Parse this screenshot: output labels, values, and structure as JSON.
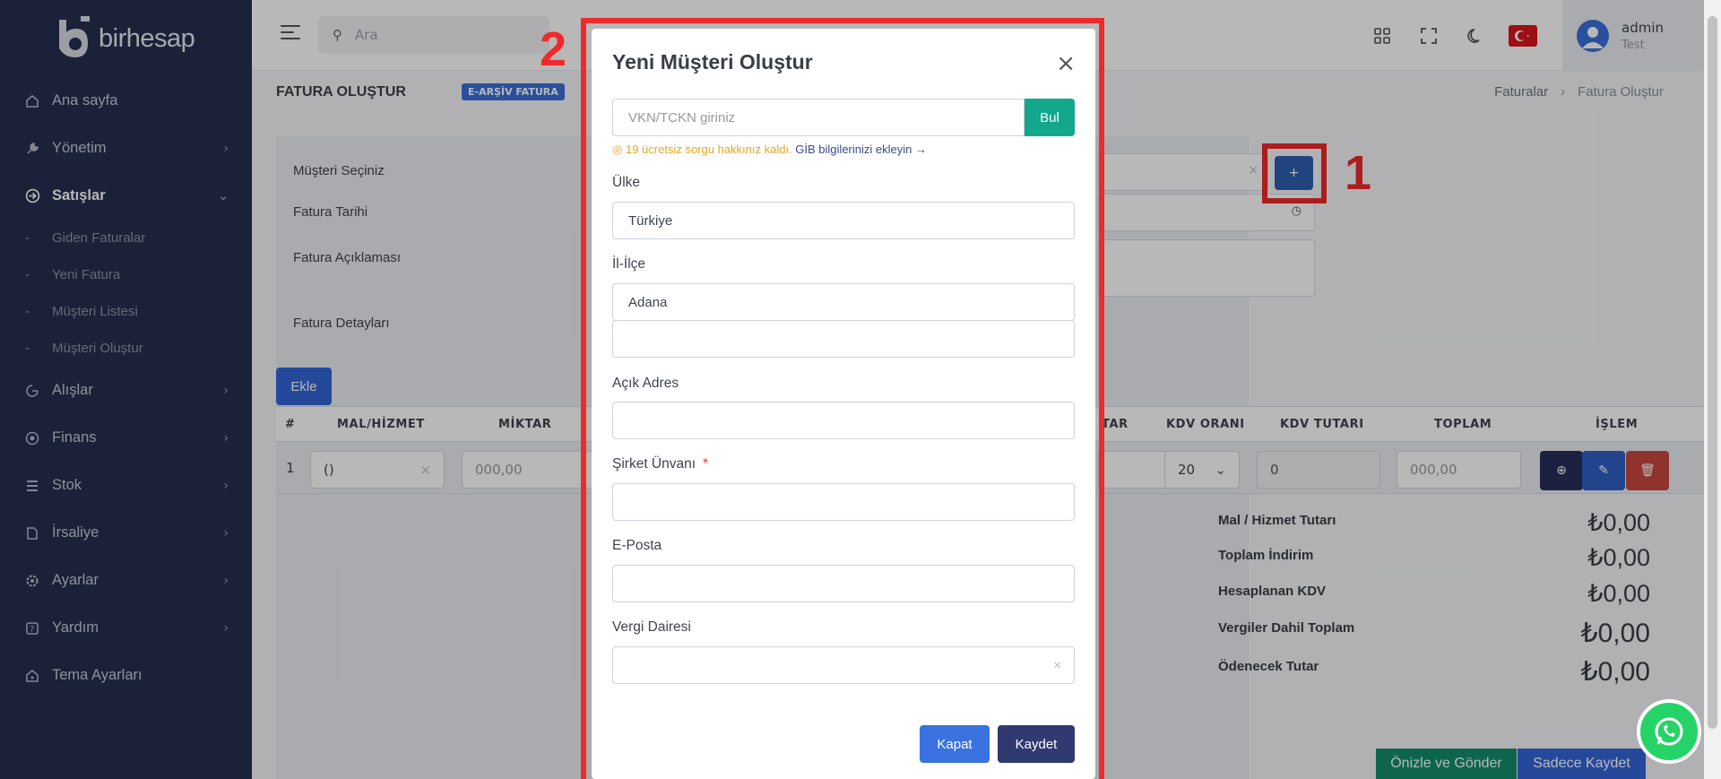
{
  "brand": {
    "name": "birhesap"
  },
  "sidebar": {
    "items": [
      {
        "label": "Ana sayfa",
        "icon": "home-icon",
        "has_children": false
      },
      {
        "label": "Yönetim",
        "icon": "wrench-icon",
        "has_children": true
      },
      {
        "label": "Satışlar",
        "icon": "sales-icon",
        "has_children": true,
        "expanded": true
      },
      {
        "label": "Alışlar",
        "icon": "purchases-icon",
        "has_children": true
      },
      {
        "label": "Finans",
        "icon": "finance-icon",
        "has_children": true
      },
      {
        "label": "Stok",
        "icon": "stock-icon",
        "has_children": true
      },
      {
        "label": "İrsaliye",
        "icon": "waybill-icon",
        "has_children": true
      },
      {
        "label": "Ayarlar",
        "icon": "gear-icon",
        "has_children": true
      },
      {
        "label": "Yardım",
        "icon": "help-icon",
        "has_children": true
      },
      {
        "label": "Tema Ayarları",
        "icon": "theme-icon",
        "has_children": false
      }
    ],
    "sales_sub": [
      "Giden Faturalar",
      "Yeni Fatura",
      "Müşteri Listesi",
      "Müşteri Oluştur"
    ]
  },
  "topbar": {
    "search_placeholder": "Ara",
    "user_name": "admin",
    "user_role": "Test"
  },
  "page": {
    "title": "FATURA OLUŞTUR",
    "badge": "E-ARŞİV FATURA",
    "breadcrumb": [
      "Faturalar",
      "Fatura Oluştur"
    ]
  },
  "form": {
    "labels": {
      "customer": "Müşteri Seçiniz",
      "date": "Fatura Tarihi",
      "description": "Fatura Açıklaması",
      "details": "Fatura Detayları"
    },
    "add_button": "Ekle",
    "plus_button": "+"
  },
  "table": {
    "headers": [
      "#",
      "MAL/HİZMET",
      "MİKTAR",
      "TAR",
      "KDV ORANI",
      "KDV TUTARI",
      "TOPLAM",
      "İŞLEM"
    ],
    "row": {
      "index": "1",
      "item": "()",
      "quantity": "000,00",
      "kdv_rate": "20",
      "kdv_amount": "0",
      "total": "000,00"
    }
  },
  "totals": [
    {
      "label": "Mal / Hizmet Tutarı",
      "value": "₺0,00"
    },
    {
      "label": "Toplam İndirim",
      "value": "₺0,00"
    },
    {
      "label": "Hesaplanan KDV",
      "value": "₺0,00"
    },
    {
      "label": "Vergiler Dahil Toplam",
      "value": "₺0,00"
    },
    {
      "label": "Ödenecek Tutar",
      "value": "₺0,00"
    }
  ],
  "bottom_buttons": {
    "preview_send": "Önizle ve Gönder",
    "save_only": "Sadece Kaydet"
  },
  "annotations": {
    "one": "1",
    "two": "2"
  },
  "modal": {
    "title": "Yeni Müşteri Oluştur",
    "vkn_placeholder": "VKN/TCKN giriniz",
    "find_button": "Bul",
    "note_warn": "19 ücretsiz sorgu hakkınız kaldı.",
    "note_link": "GİB bilgilerinizi ekleyin →",
    "country_label": "Ülke",
    "country_value": "Türkiye",
    "city_label": "İl-İlçe",
    "city_value": "Adana",
    "district_value": "",
    "address_label": "Açık Adres",
    "company_label": "Şirket Ünvanı",
    "company_required": "*",
    "email_label": "E-Posta",
    "tax_office_label": "Vergi Dairesi",
    "close_button": "Kapat",
    "save_button": "Kaydet"
  },
  "colors": {
    "sidebar_bg": "#262f4f",
    "accent_blue": "#3466d6",
    "find_green": "#13a78c",
    "save_navy": "#303a70",
    "highlight_red": "#ee2a2a",
    "whatsapp_green": "#25d366"
  }
}
